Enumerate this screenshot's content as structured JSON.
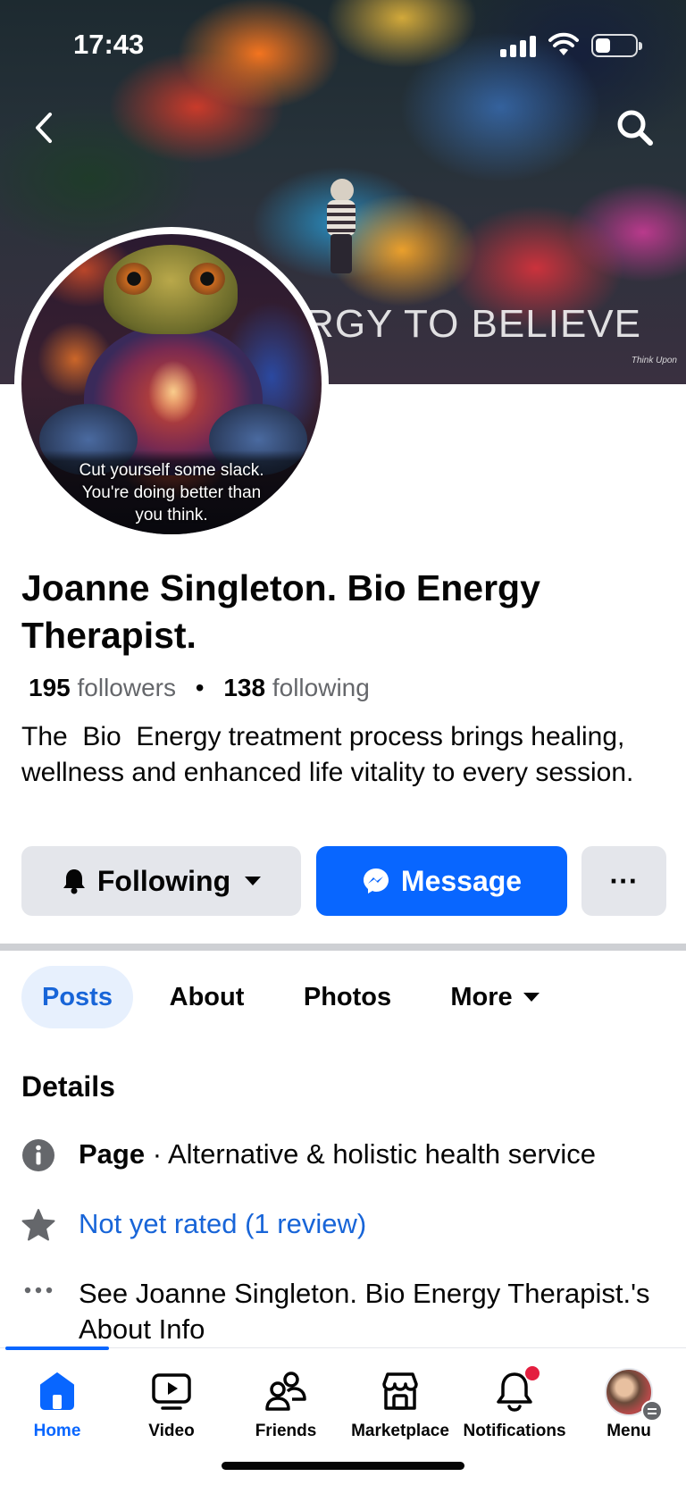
{
  "status_bar": {
    "time": "17:43"
  },
  "cover": {
    "text": "RGY TO BELIEVE",
    "watermark": "Think Upon"
  },
  "avatar": {
    "quote": "Cut yourself some slack.\nYou're doing better than\nyou think."
  },
  "profile": {
    "name": "Joanne Singleton. Bio Energy Therapist.",
    "followers_count": "195",
    "followers_label": "followers",
    "following_count": "138",
    "following_label": "following",
    "bio": "The  Bio  Energy treatment process brings healing, wellness and enhanced life vitality to every session."
  },
  "actions": {
    "following_label": "Following",
    "message_label": "Message",
    "more_label": "···"
  },
  "tabs": [
    {
      "label": "Posts",
      "active": true
    },
    {
      "label": "About"
    },
    {
      "label": "Photos"
    },
    {
      "label": "More"
    }
  ],
  "details": {
    "title": "Details",
    "page_label": "Page",
    "page_category": " · Alternative & holistic health service",
    "rating": "Not yet rated (1 review)",
    "about_link": "See Joanne Singleton. Bio Energy Therapist.'s About Info"
  },
  "bottom_nav": [
    {
      "label": "Home",
      "icon": "home-icon",
      "active": true
    },
    {
      "label": "Video",
      "icon": "video-icon"
    },
    {
      "label": "Friends",
      "icon": "friends-icon"
    },
    {
      "label": "Marketplace",
      "icon": "marketplace-icon"
    },
    {
      "label": "Notifications",
      "icon": "bell-icon",
      "badge": true
    },
    {
      "label": "Menu",
      "icon": "menu-avatar"
    }
  ],
  "colors": {
    "accent": "#0866ff",
    "link": "#1865d8",
    "secondary_text": "#65676b",
    "button_gray": "#e4e6eb",
    "notification_red": "#e41e3f"
  }
}
